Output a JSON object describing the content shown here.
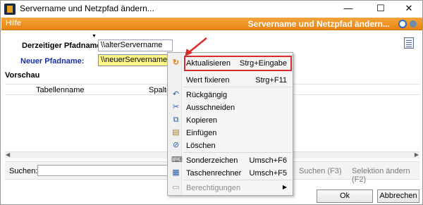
{
  "window": {
    "title": "Servername und Netzpfad ändern...",
    "controls": {
      "minimize": "—",
      "maximize": "☐",
      "close": "✕"
    }
  },
  "menubar": {
    "help": "Hilfe",
    "title": "Servername und Netzpfad ändern..."
  },
  "form": {
    "current_label": "Derzeitiger Pfadname:",
    "current_value": "\\\\alterServername",
    "new_label": "Neuer Pfadname:",
    "new_value": "\\\\neuerServername"
  },
  "preview": {
    "title": "Vorschau",
    "columns": [
      "Tabellenname",
      "Spalte"
    ]
  },
  "search": {
    "label": "Suchen:",
    "value": "",
    "search_button": "Suchen (F3)",
    "selection_button": "Selektion ändern (F2)"
  },
  "buttons": {
    "ok": "Ok",
    "cancel": "Abbrechen"
  },
  "context_menu": {
    "items": [
      {
        "label": "Aktualisieren",
        "shortcut": "Strg+Eingabe",
        "icon": "refresh-icon"
      },
      {
        "label": "Wert fixieren",
        "shortcut": "Strg+F11",
        "icon": ""
      },
      {
        "label": "Rückgängig",
        "shortcut": "",
        "icon": "undo-icon"
      },
      {
        "label": "Ausschneiden",
        "shortcut": "",
        "icon": "scissors-icon"
      },
      {
        "label": "Kopieren",
        "shortcut": "",
        "icon": "copy-icon"
      },
      {
        "label": "Einfügen",
        "shortcut": "",
        "icon": "paste-icon"
      },
      {
        "label": "Löschen",
        "shortcut": "",
        "icon": "delete-icon"
      },
      {
        "label": "Sonderzeichen",
        "shortcut": "Umsch+F6",
        "icon": "keyboard-icon"
      },
      {
        "label": "Taschenrechner",
        "shortcut": "Umsch+F5",
        "icon": "calculator-icon"
      },
      {
        "label": "Berechtigungen",
        "shortcut": "",
        "icon": "permissions-icon"
      }
    ]
  },
  "colors": {
    "menubar": "#e88512",
    "highlight": "#d92b2b",
    "new_label": "#1a2f9e",
    "new_field": "#fff68a"
  }
}
